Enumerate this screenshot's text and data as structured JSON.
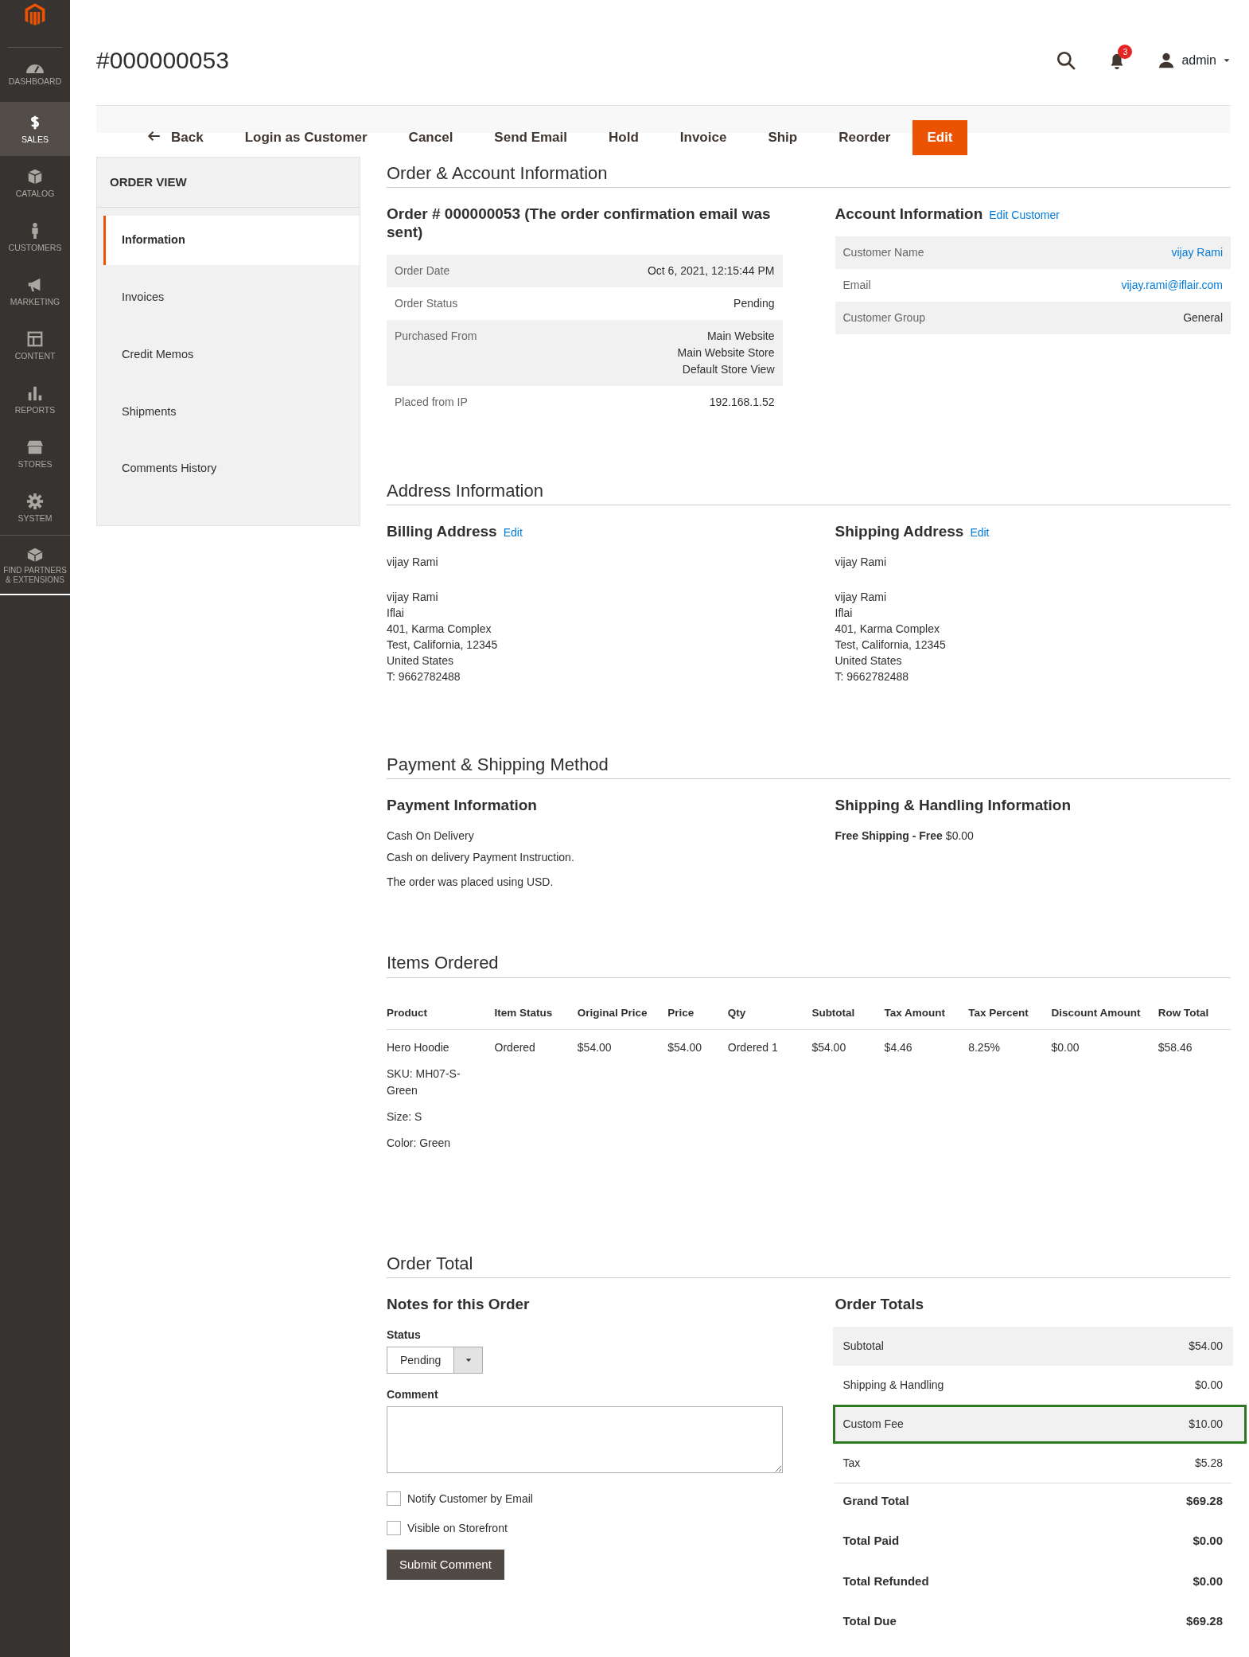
{
  "sidebar": {
    "items": [
      {
        "kind": "dashboard",
        "label": "DASHBOARD",
        "selected": false
      },
      {
        "kind": "sales",
        "label": "SALES",
        "selected": true
      },
      {
        "kind": "catalog",
        "label": "CATALOG",
        "selected": false
      },
      {
        "kind": "customers",
        "label": "CUSTOMERS",
        "selected": false
      },
      {
        "kind": "marketing",
        "label": "MARKETING",
        "selected": false
      },
      {
        "kind": "content",
        "label": "CONTENT",
        "selected": false
      },
      {
        "kind": "reports",
        "label": "REPORTS",
        "selected": false
      },
      {
        "kind": "stores",
        "label": "STORES",
        "selected": false
      },
      {
        "kind": "system",
        "label": "SYSTEM",
        "selected": false
      },
      {
        "kind": "partners",
        "label": "FIND PARTNERS & EXTENSIONS",
        "selected": false
      }
    ]
  },
  "header": {
    "title": "#000000053",
    "notification_count": "3",
    "user": "admin"
  },
  "toolbar": [
    {
      "kind": "back",
      "label": "Back"
    },
    {
      "kind": "plain",
      "label": "Login as Customer"
    },
    {
      "kind": "plain",
      "label": "Cancel"
    },
    {
      "kind": "plain",
      "label": "Send Email"
    },
    {
      "kind": "plain",
      "label": "Hold"
    },
    {
      "kind": "plain",
      "label": "Invoice"
    },
    {
      "kind": "plain",
      "label": "Ship"
    },
    {
      "kind": "plain",
      "label": "Reorder"
    },
    {
      "kind": "primary",
      "label": "Edit"
    }
  ],
  "order_view": {
    "title": "ORDER VIEW",
    "tabs": [
      {
        "label": "Information",
        "selected": true
      },
      {
        "label": "Invoices",
        "selected": false
      },
      {
        "label": "Credit Memos",
        "selected": false
      },
      {
        "label": "Shipments",
        "selected": false
      },
      {
        "label": "Comments History",
        "selected": false
      }
    ]
  },
  "order_account": {
    "title": "Order & Account Information",
    "order": {
      "title": "Order # 000000053 (The order confirmation email was sent)",
      "rows": [
        {
          "label": "Order Date",
          "value": [
            "Oct 6, 2021, 12:15:44 PM"
          ]
        },
        {
          "label": "Order Status",
          "value": [
            "Pending"
          ]
        },
        {
          "label": "Purchased From",
          "value": [
            "Main Website",
            "Main Website Store",
            "Default Store View"
          ]
        },
        {
          "label": "Placed from IP",
          "value": [
            "192.168.1.52"
          ]
        }
      ]
    },
    "account": {
      "title": "Account Information",
      "link": "Edit Customer",
      "rows": [
        {
          "label": "Customer Name",
          "value": "vijay Rami",
          "link": true
        },
        {
          "label": "Email",
          "value": "vijay.rami@iflair.com",
          "link": true
        },
        {
          "label": "Customer Group",
          "value": "General",
          "link": false
        }
      ]
    }
  },
  "address": {
    "title": "Address Information",
    "blocks": [
      {
        "title": "Billing Address",
        "link": "Edit",
        "name": "vijay Rami",
        "lines": [
          "vijay Rami",
          "Iflai",
          "401, Karma Complex",
          "Test, California, 12345",
          "United States",
          "T: 9662782488"
        ]
      },
      {
        "title": "Shipping Address",
        "link": "Edit",
        "name": "vijay Rami",
        "lines": [
          "vijay Rami",
          "Iflai",
          "401, Karma Complex",
          "Test, California, 12345",
          "United States",
          "T: 9662782488"
        ]
      }
    ]
  },
  "payment_shipping": {
    "title": "Payment & Shipping Method",
    "payment": {
      "title": "Payment Information",
      "lines": [
        "Cash On Delivery",
        "Cash on delivery Payment Instruction.",
        "The order was placed using USD."
      ]
    },
    "shipping": {
      "title": "Shipping & Handling Information",
      "method": "Free Shipping - Free",
      "price": "$0.00"
    }
  },
  "items": {
    "title": "Items Ordered",
    "columns": [
      "Product",
      "Item Status",
      "Original Price",
      "Price",
      "Qty",
      "Subtotal",
      "Tax Amount",
      "Tax Percent",
      "Discount Amount",
      "Row Total"
    ],
    "rows": [
      {
        "details": [
          "SKU: MH07-S-Green",
          "Size: S",
          "Color: Green"
        ],
        "cells": [
          "Hero Hoodie",
          "Ordered",
          "$54.00",
          "$54.00",
          "Ordered 1",
          "$54.00",
          "$4.46",
          "8.25%",
          "$0.00",
          "$58.46"
        ]
      }
    ]
  },
  "order_total": {
    "title": "Order Total",
    "notes": {
      "title": "Notes for this Order",
      "status_label": "Status",
      "status": "Pending",
      "comment_label": "Comment",
      "options": [
        {
          "label": "Notify Customer by Email",
          "checked": false
        },
        {
          "label": "Visible on Storefront",
          "checked": false
        }
      ],
      "submit": "Submit Comment"
    },
    "totals": {
      "title": "Order Totals",
      "rows": [
        {
          "kind": "line",
          "label": "Subtotal",
          "value": "$54.00",
          "highlighted": false
        },
        {
          "kind": "line",
          "label": "Shipping & Handling",
          "value": "$0.00",
          "highlighted": false
        },
        {
          "kind": "line",
          "label": "Custom Fee",
          "value": "$10.00",
          "highlighted": true
        },
        {
          "kind": "line",
          "label": "Tax",
          "value": "$5.28",
          "highlighted": false
        },
        {
          "kind": "grand",
          "label": "Grand Total",
          "value": "$69.28",
          "highlighted": false
        },
        {
          "kind": "grand",
          "label": "Total Paid",
          "value": "$0.00",
          "highlighted": false
        },
        {
          "kind": "grand",
          "label": "Total Refunded",
          "value": "$0.00",
          "highlighted": false
        },
        {
          "kind": "grand",
          "label": "Total Due",
          "value": "$69.28",
          "highlighted": false
        }
      ]
    }
  }
}
